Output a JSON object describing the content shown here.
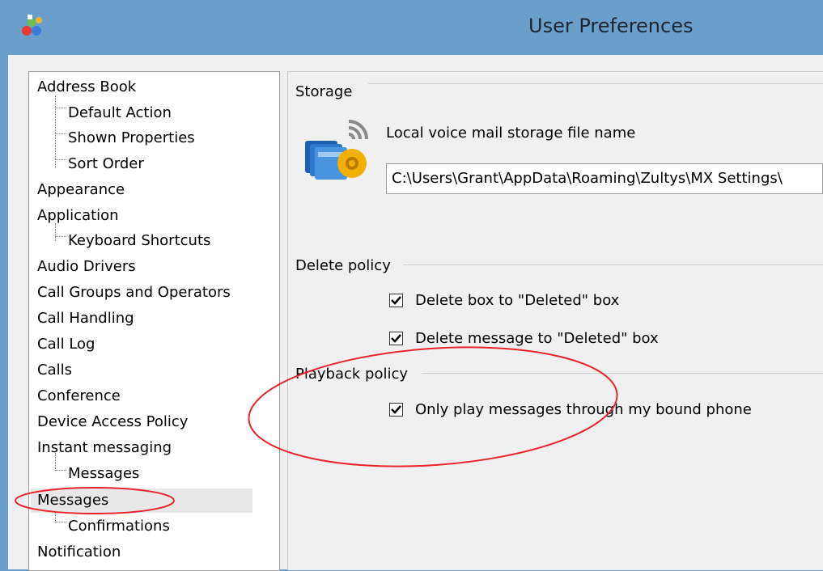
{
  "window": {
    "title": "User Preferences"
  },
  "tree": {
    "items": [
      {
        "label": "Address Book",
        "level": 0
      },
      {
        "label": "Default Action",
        "level": 1
      },
      {
        "label": "Shown Properties",
        "level": 1
      },
      {
        "label": "Sort Order",
        "level": 1
      },
      {
        "label": "Appearance",
        "level": 0
      },
      {
        "label": "Application",
        "level": 0
      },
      {
        "label": "Keyboard Shortcuts",
        "level": 1
      },
      {
        "label": "Audio Drivers",
        "level": 0
      },
      {
        "label": "Call Groups and Operators",
        "level": 0
      },
      {
        "label": "Call Handling",
        "level": 0
      },
      {
        "label": "Call Log",
        "level": 0
      },
      {
        "label": "Calls",
        "level": 0
      },
      {
        "label": "Conference",
        "level": 0
      },
      {
        "label": "Device Access Policy",
        "level": 0
      },
      {
        "label": "Instant messaging",
        "level": 0
      },
      {
        "label": "Messages",
        "level": 1
      },
      {
        "label": "Messages",
        "level": 0,
        "selected": true
      },
      {
        "label": "Confirmations",
        "level": 1
      },
      {
        "label": "Notification",
        "level": 0
      }
    ]
  },
  "storage": {
    "group_label": "Storage",
    "field_label": "Local voice mail storage file name",
    "path_value": "C:\\Users\\Grant\\AppData\\Roaming\\Zultys\\MX Settings\\"
  },
  "delete_policy": {
    "group_label": "Delete policy",
    "options": [
      {
        "label": "Delete box to \"Deleted\" box",
        "checked": true
      },
      {
        "label": "Delete message to \"Deleted\" box",
        "checked": true
      }
    ]
  },
  "playback_policy": {
    "group_label": "Playback policy",
    "options": [
      {
        "label": "Only play messages through my bound phone",
        "checked": true
      }
    ]
  },
  "colors": {
    "titlebar": "#6b9fcb",
    "annotation": "#e8232b",
    "selected_bg": "#e8e8e8"
  }
}
